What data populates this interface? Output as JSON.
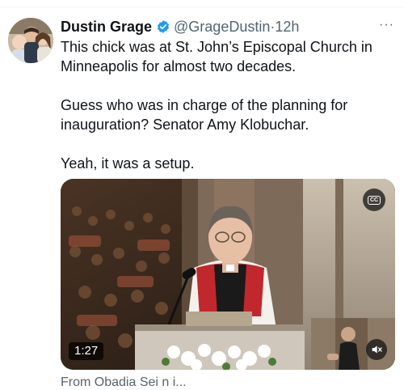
{
  "tweet": {
    "author_name": "Dustin Grage",
    "author_handle": "@GrageDustin",
    "separator": "·",
    "time": "12h",
    "more_label": "···",
    "paragraphs": [
      "This chick was at St. John’s Episcopal Church in Minneapolis for almost two decades.",
      "Guess who was in charge of the planning for inauguration? Senator Amy Klobuchar.",
      "Yeah, it was a setup."
    ],
    "video": {
      "duration": "1:27",
      "cc_label": "CC"
    },
    "quote_peek": "From Obadia Sei n i..."
  },
  "colors": {
    "verified": "#1d9bf0",
    "secondary_text": "#536471",
    "primary_text": "#0f1419"
  },
  "icons": [
    "verified-badge-icon",
    "more-icon",
    "closed-captions-icon",
    "mute-icon"
  ]
}
